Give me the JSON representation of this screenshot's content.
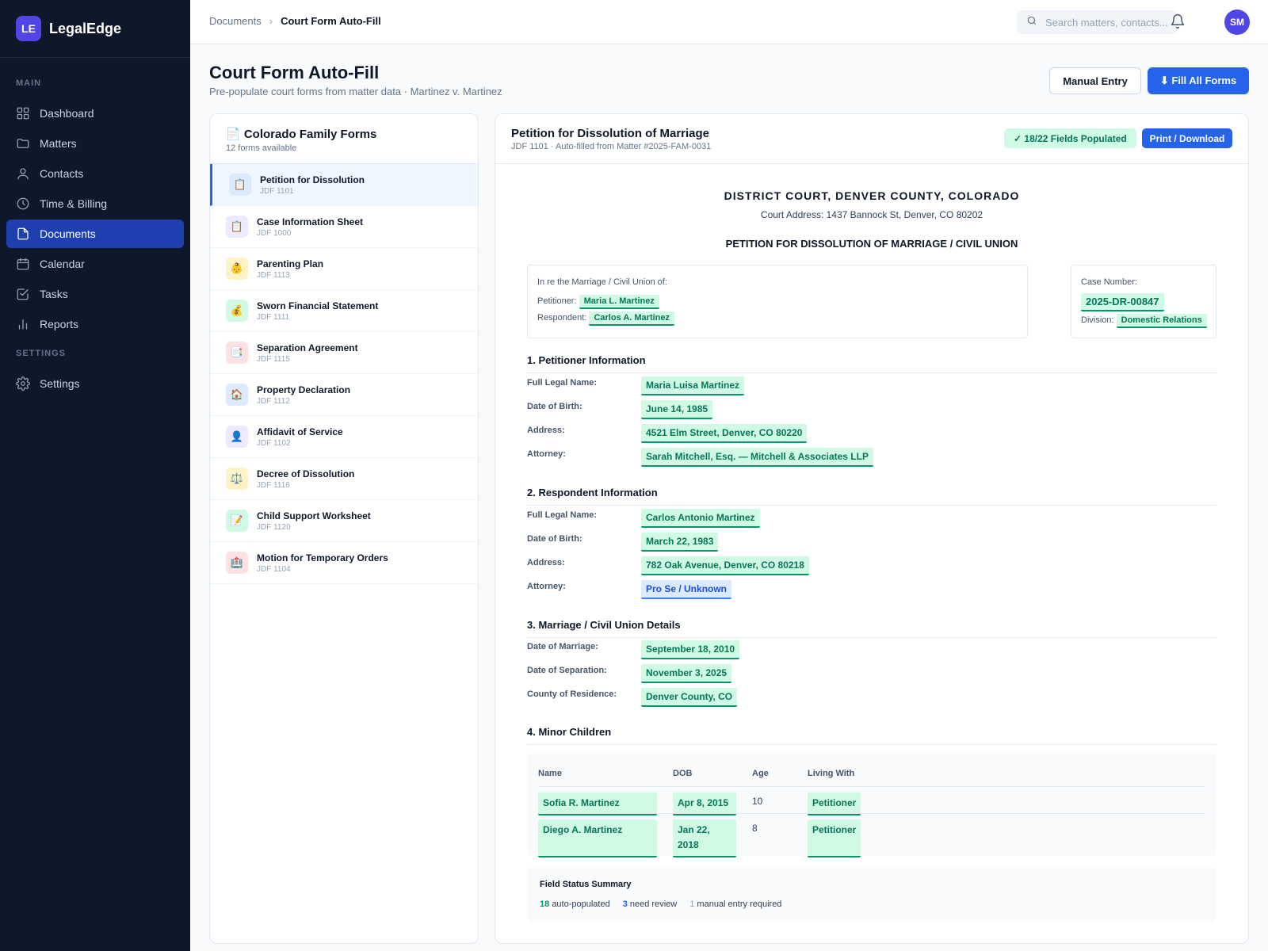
{
  "app": {
    "logo": "LE",
    "name": "LegalEdge"
  },
  "sidebar": {
    "section_main": "MAIN",
    "section_settings": "SETTINGS",
    "items": [
      {
        "label": "Dashboard",
        "icon": "dashboard-icon"
      },
      {
        "label": "Matters",
        "icon": "folder-icon"
      },
      {
        "label": "Contacts",
        "icon": "user-icon"
      },
      {
        "label": "Time & Billing",
        "icon": "clock-icon"
      },
      {
        "label": "Documents",
        "icon": "document-icon",
        "active": true
      },
      {
        "label": "Calendar",
        "icon": "calendar-icon"
      },
      {
        "label": "Tasks",
        "icon": "task-check-icon"
      },
      {
        "label": "Reports",
        "icon": "bar-chart-icon"
      }
    ],
    "settings_item": {
      "label": "Settings",
      "icon": "gear-icon"
    }
  },
  "topbar": {
    "breadcrumb": [
      "Documents",
      "Court Form Auto-Fill"
    ],
    "search_placeholder": "Search matters, contacts...",
    "avatar": "SM"
  },
  "page": {
    "title": "Court Form Auto-Fill",
    "subtitle": "Pre-populate court forms from matter data · Martinez v. Martinez",
    "manual_entry": "Manual Entry",
    "fill_all": "⬇ Fill All Forms"
  },
  "forms_panel": {
    "title": "📄 Colorado Family Forms",
    "count": "12 forms available",
    "forms": [
      {
        "name": "Petition for Dissolution",
        "code": "JDF 1101",
        "icon": "📋",
        "bg": "#dbeafe",
        "active": true
      },
      {
        "name": "Case Information Sheet",
        "code": "JDF 1000",
        "icon": "📋",
        "bg": "#ede9fe"
      },
      {
        "name": "Parenting Plan",
        "code": "JDF 1113",
        "icon": "👶",
        "bg": "#fef3c7"
      },
      {
        "name": "Sworn Financial Statement",
        "code": "JDF 1111",
        "icon": "💰",
        "bg": "#d1fae5"
      },
      {
        "name": "Separation Agreement",
        "code": "JDF 1115",
        "icon": "📑",
        "bg": "#fee2e2"
      },
      {
        "name": "Property Declaration",
        "code": "JDF 1112",
        "icon": "🏠",
        "bg": "#dbeafe"
      },
      {
        "name": "Affidavit of Service",
        "code": "JDF 1102",
        "icon": "👤",
        "bg": "#ede9fe"
      },
      {
        "name": "Decree of Dissolution",
        "code": "JDF 1116",
        "icon": "⚖️",
        "bg": "#fef3c7"
      },
      {
        "name": "Child Support Worksheet",
        "code": "JDF 1120",
        "icon": "📝",
        "bg": "#d1fae5"
      },
      {
        "name": "Motion for Temporary Orders",
        "code": "JDF 1104",
        "icon": "🏥",
        "bg": "#fee2e2"
      }
    ]
  },
  "document": {
    "title": "Petition for Dissolution of Marriage",
    "subtitle": "JDF 1101 · Auto-filled from Matter #2025-FAM-0031",
    "populated_badge": "✓ 18/22 Fields Populated",
    "print_button": "Print / Download",
    "court_name": "DISTRICT COURT, DENVER COUNTY, COLORADO",
    "court_address": "Court Address: 1437 Bannock St, Denver, CO 80202",
    "petition_title": "PETITION FOR DISSOLUTION OF MARRIAGE / CIVIL UNION",
    "caption": {
      "heading": "In re the Marriage / Civil Union of:",
      "petitioner_label": "Petitioner:",
      "petitioner": "Maria L. Martinez",
      "respondent_label": "Respondent:",
      "respondent": "Carlos A. Martinez"
    },
    "case": {
      "number_label": "Case Number:",
      "number": "2025-DR-00847",
      "division_label": "Division:",
      "division": "Domestic Relations"
    },
    "sections": {
      "petitioner": {
        "title": "1. Petitioner Information",
        "fields": [
          {
            "label": "Full Legal Name:",
            "value": "Maria Luisa Martinez"
          },
          {
            "label": "Date of Birth:",
            "value": "June 14, 1985"
          },
          {
            "label": "Address:",
            "value": "4521 Elm Street, Denver, CO 80220"
          },
          {
            "label": "Attorney:",
            "value": "Sarah Mitchell, Esq. — Mitchell & Associates LLP"
          }
        ]
      },
      "respondent": {
        "title": "2. Respondent Information",
        "fields": [
          {
            "label": "Full Legal Name:",
            "value": "Carlos Antonio Martinez"
          },
          {
            "label": "Date of Birth:",
            "value": "March 22, 1983"
          },
          {
            "label": "Address:",
            "value": "782 Oak Avenue, Denver, CO 80218"
          },
          {
            "label": "Attorney:",
            "value": "Pro Se / Unknown",
            "status": "review"
          }
        ]
      },
      "marriage": {
        "title": "3. Marriage / Civil Union Details",
        "fields": [
          {
            "label": "Date of Marriage:",
            "value": "September 18, 2010"
          },
          {
            "label": "Date of Separation:",
            "value": "November 3, 2025"
          },
          {
            "label": "County of Residence:",
            "value": "Denver County, CO"
          }
        ]
      },
      "children": {
        "title": "4. Minor Children",
        "columns": [
          "Name",
          "DOB",
          "Age",
          "Living With"
        ],
        "rows": [
          {
            "name": "Sofia R. Martinez",
            "dob": "Apr 8, 2015",
            "age": "10",
            "living_with": "Petitioner"
          },
          {
            "name": "Diego A. Martinez",
            "dob": "Jan 22, 2018",
            "age": "8",
            "living_with": "Petitioner"
          }
        ]
      }
    },
    "summary": {
      "title": "Field Status Summary",
      "auto_count": "18",
      "auto_label": "auto-populated",
      "review_count": "3",
      "review_label": "need review",
      "manual_count": "1",
      "manual_label": "manual entry required"
    }
  }
}
